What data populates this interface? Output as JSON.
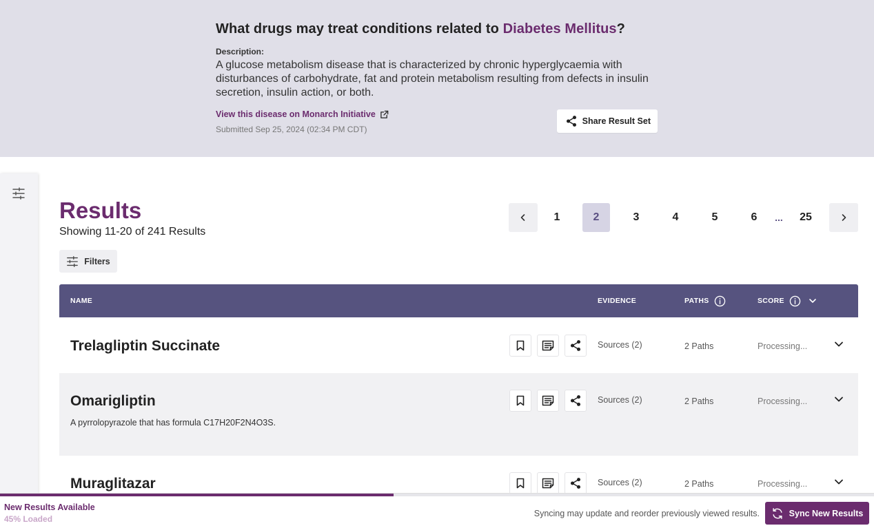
{
  "header": {
    "question_prefix": "What drugs may treat conditions related to ",
    "disease": "Diabetes Mellitus",
    "question_suffix": "?",
    "description_label": "Description:",
    "description": "A glucose metabolism disease that is characterized by chronic hyperglycaemia with disturbances of carbohydrate, fat and protein metabolism resulting from defects in insulin secretion, insulin action, or both.",
    "monarch_link": "View this disease on Monarch Initiative",
    "submitted": "Submitted Sep 25, 2024 (02:34 PM CDT)",
    "share_button": "Share Result Set"
  },
  "results": {
    "title": "Results",
    "count": "Showing 11-20 of 241 Results",
    "filters_button": "Filters"
  },
  "pagination": {
    "pages": [
      "1",
      "2",
      "3",
      "4",
      "5",
      "6"
    ],
    "current": "2",
    "ellipsis": "...",
    "last": "25"
  },
  "table": {
    "columns": {
      "name": "NAME",
      "evidence": "EVIDENCE",
      "paths": "PATHS",
      "score": "SCORE"
    },
    "rows": [
      {
        "name": "Trelagliptin Succinate",
        "description": "",
        "evidence": "Sources (2)",
        "paths": "2 Paths",
        "score": "Processing..."
      },
      {
        "name": "Omarigliptin",
        "description": "A pyrrolopyrazole that has formula C17H20F2N4O3S.",
        "evidence": "Sources (2)",
        "paths": "2 Paths",
        "score": "Processing..."
      },
      {
        "name": "Muraglitazar",
        "description": "",
        "evidence": "Sources (2)",
        "paths": "2 Paths",
        "score": "Processing..."
      }
    ]
  },
  "footer": {
    "new_results": "New Results Available",
    "loaded": "45% Loaded",
    "progress": 0.45,
    "sync_note": "Syncing may update and reorder previously viewed results.",
    "sync_button": "Sync New Results"
  },
  "colors": {
    "brand": "#6b2c6e",
    "table_header": "#56537f",
    "header_band": "#e0dfe8"
  }
}
